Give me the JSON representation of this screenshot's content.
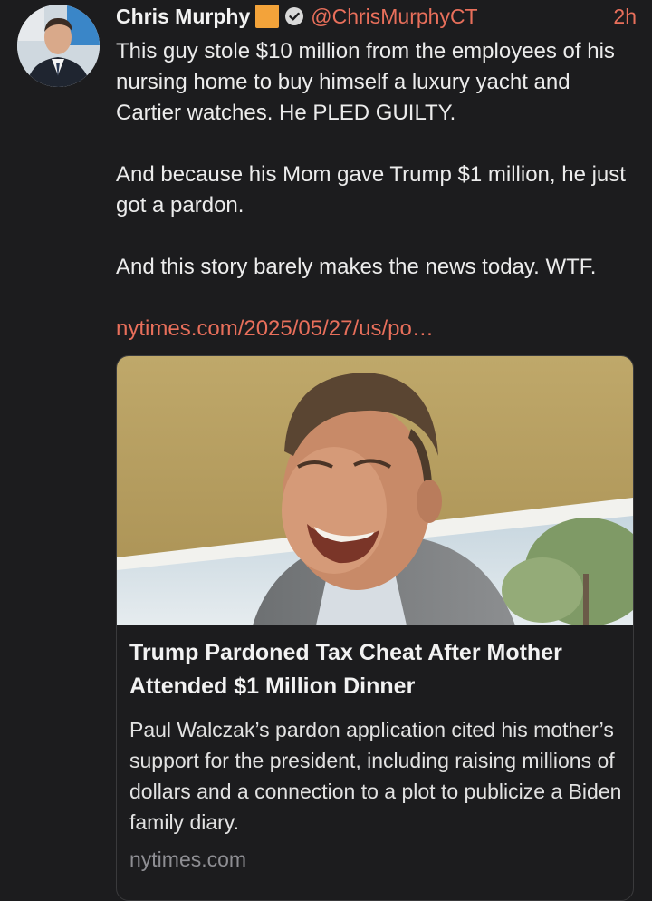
{
  "post": {
    "author": {
      "display_name": "Chris Murphy",
      "handle": "@ChrisMurphyCT",
      "badge_color": "#f3a33a",
      "verified_icon": "verified-check-icon"
    },
    "timestamp": "2h",
    "text": "This guy stole $10 million from the employees of his nursing home to buy himself a luxury yacht and Cartier watches. He PLED GUILTY.\n\nAnd because his Mom gave Trump $1 million, he just got a pardon.\n\nAnd this story barely makes the news today. WTF.",
    "link_text": "nytimes.com/2025/05/27/us/po…",
    "link_color": "#e86f5b",
    "card": {
      "title": "Trump Pardoned Tax Cheat After Mother Attended $1 Million Dinner",
      "description": "Paul Walczak’s pardon application cited his mother’s support for the president, including raising millions of dollars and a connection to a plot to publicize a Biden family diary.",
      "domain": "nytimes.com"
    }
  }
}
